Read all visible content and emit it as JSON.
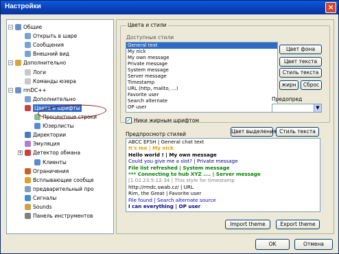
{
  "window": {
    "title": "Настройки",
    "close_glyph": "×"
  },
  "tree": {
    "items": [
      {
        "label": "Общие",
        "icon": "gear-icon",
        "expander": "−",
        "color": "#6b8fc9"
      },
      {
        "label": "Открыть в шаре",
        "icon": "doc-icon",
        "color": "#7aa0d8"
      },
      {
        "label": "Сообщения",
        "icon": "doc-icon",
        "color": "#7aa0d8"
      },
      {
        "label": "Внешний вид",
        "icon": "doc-icon",
        "color": "#7aa0d8"
      },
      {
        "label": "Дополнительно",
        "icon": "folder-icon",
        "expander": "−",
        "color": "#d4a640"
      },
      {
        "label": "Логи",
        "icon": "doc-icon",
        "color": "#c8c8c8"
      },
      {
        "label": "Команды юзера",
        "icon": "doc-icon",
        "color": "#c8c8c8"
      },
      {
        "label": "rmDC++",
        "icon": "gear-icon",
        "expander": "−",
        "color": "#6b8fc9"
      },
      {
        "label": "Дополнительно",
        "icon": "doc-icon",
        "color": "#7aa0d8"
      },
      {
        "label": "Цвета и шрифты",
        "icon": "palette-icon",
        "color": "#c84040"
      },
      {
        "label": "Процентные строки",
        "icon": "doc-icon",
        "color": "#88c088"
      },
      {
        "label": "Юзерлисты",
        "icon": "users-icon",
        "color": "#5a8ad0"
      },
      {
        "label": "Директории",
        "icon": "folder-icon",
        "color": "#4a7ac0"
      },
      {
        "label": "Эмуляция",
        "icon": "gear-icon",
        "color": "#b080d0"
      },
      {
        "label": "Детектор обмана",
        "icon": "shield-icon",
        "expander": "+",
        "color": "#c84040"
      },
      {
        "label": "Клиенты",
        "icon": "users-icon",
        "color": "#5a8ad0"
      },
      {
        "label": "Ограничения",
        "icon": "limit-icon",
        "color": "#d06020"
      },
      {
        "label": "Всплывающие сообще",
        "icon": "popup-icon",
        "color": "#e0a030"
      },
      {
        "label": "предварительный про",
        "icon": "preview-icon",
        "color": "#80a0c0"
      },
      {
        "label": "Сигналы",
        "icon": "signal-icon",
        "color": "#4090d0"
      },
      {
        "label": "Sounds",
        "icon": "sound-icon",
        "color": "#d0a040"
      },
      {
        "label": "Панель инструментов",
        "icon": "toolbar-icon",
        "color": "#808080"
      }
    ]
  },
  "styles_group": {
    "title": "Цвета и стили",
    "list_header": "Доступные стили",
    "items": [
      "General text",
      "My nick",
      "My own message",
      "Private message",
      "System message",
      "Server message",
      "Timestamp",
      "URL (http, mailto, ...)",
      "Favorite user",
      "Search alternate",
      "OP user"
    ],
    "selected_index": 0,
    "buttons": {
      "bg_color": "Цвет фона",
      "text_color": "Цвет текста",
      "text_style": "Стиль текста",
      "bold": "жирн",
      "default": "Сброс"
    },
    "preset_label": "Предопред",
    "preset_value": "",
    "bold_checkbox_label": "Ники жирным шрифтом",
    "bold_checkbox_checked": true
  },
  "preview": {
    "label": "Предпросмотр стилей",
    "select_color_button": "Цвет выделения",
    "text_style_button": "Стиль текста",
    "lines": [
      {
        "text": "ABCC EFSH | General chat text",
        "color": "#000000",
        "bold": false
      },
      {
        "text": "It's me | My nick",
        "color": "#e0a000",
        "bold": true
      },
      {
        "text": "Hello world ! | My own message",
        "color": "#000000",
        "bold": true
      },
      {
        "text": "Could you give me a slot? | Private message",
        "color": "#000080",
        "bold": false
      },
      {
        "text": "File list refreshed | System message",
        "color": "#008000",
        "bold": true
      },
      {
        "text": "*** Connecting to hub XYZ .... | Server message",
        "color": "#008000",
        "bold": true
      },
      {
        "text": "[1.02.23:5:12:34 | This style for timestamp",
        "color": "#808080",
        "bold": false
      },
      {
        "text": "http://rmdc.swab.cz/ | URL",
        "color": "#000000",
        "bold": false
      },
      {
        "text": "Rim, the Great | Favorite user",
        "color": "#000000",
        "bold": false
      },
      {
        "text": "File found | Search alternate source",
        "color": "#0000c0",
        "bold": false
      },
      {
        "text": "I can everything | OP user",
        "color": "#000080",
        "bold": true
      }
    ]
  },
  "footer": {
    "import_theme": "Import theme",
    "export_theme": "Export theme",
    "ok": "OK",
    "cancel": "Отмена"
  }
}
